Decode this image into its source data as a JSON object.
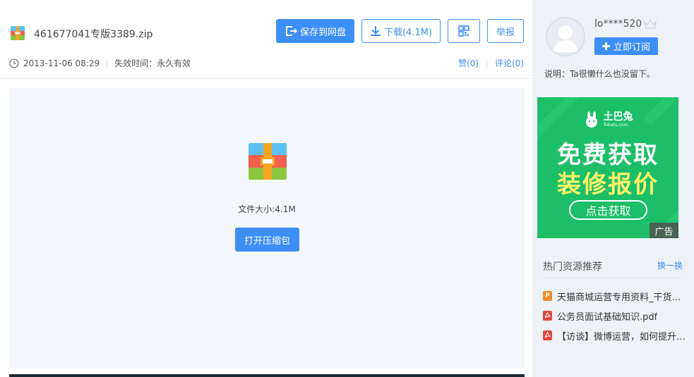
{
  "file": {
    "name": "461677041专版3389.zip",
    "date": "2013-11-06 08:29",
    "expiry_label": "失效时间：永久有效",
    "size_label": "文件大小:4.1M"
  },
  "toolbar": {
    "save_label": "保存到网盘",
    "download_label": "下载(4.1M)",
    "report_label": "举报"
  },
  "actions": {
    "like_label": "赞(0)",
    "comment_label": "评论(0)"
  },
  "preview": {
    "open_label": "打开压缩包"
  },
  "user": {
    "name": "lo****520",
    "subscribe_label": "立即订阅",
    "description": "说明：Ta很懒什么也没留下。"
  },
  "ad": {
    "brand_cn": "土巴兔",
    "brand_en": "Tubatu.com",
    "headline1": "免费获取",
    "headline2": "装修报价",
    "cta": "点击获取",
    "tag": "广告"
  },
  "hot": {
    "title": "热门资源推荐",
    "switch_label": "换一换",
    "items": [
      {
        "title": "天猫商城运营专用资料_干货版.p...",
        "type": "ppt",
        "icon_letter": "P",
        "color": "#f08c2b"
      },
      {
        "title": "公务员面试基础知识.pdf",
        "type": "pdf",
        "icon_letter": "",
        "color": "#e0473e"
      },
      {
        "title": "【访谈】微博运营，如何提升企...",
        "type": "pdf",
        "icon_letter": "",
        "color": "#e0473e"
      }
    ]
  },
  "colors": {
    "accent": "#3e8ef7",
    "ad_green": "#1cbf67",
    "ad_yellow": "#fff46a"
  }
}
